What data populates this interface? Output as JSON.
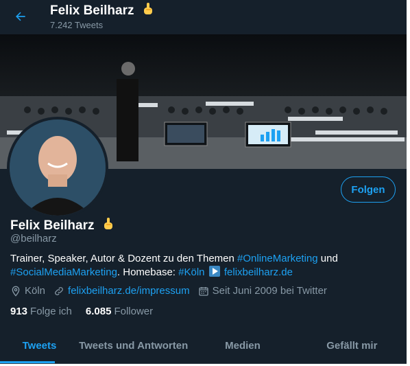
{
  "header": {
    "name": "Felix Beilharz",
    "tweet_count": "7.242 Tweets"
  },
  "profile": {
    "follow_label": "Folgen",
    "name": "Felix Beilharz",
    "handle": "@beilharz",
    "bio": {
      "line1_text": "Trainer, Speaker, Autor & Dozent zu den Themen ",
      "hashtag1": "#OnlineMarketing",
      "line1_end": " und",
      "hashtag2": "#SocialMediaMarketing",
      "homebase": ". Homebase: ",
      "hashtag3": "#Köln",
      "website": "felixbeilharz.de"
    },
    "location": "Köln",
    "url": "felixbeilharz.de/impressum",
    "joined": "Seit Juni 2009 bei Twitter",
    "following_count": "913",
    "following_label": "Folge ich",
    "followers_count": "6.085",
    "followers_label": "Follower"
  },
  "tabs": [
    {
      "label": "Tweets",
      "active": true
    },
    {
      "label": "Tweets und Antworten",
      "active": false
    },
    {
      "label": "Medien",
      "active": false
    },
    {
      "label": "Gefällt mir",
      "active": false
    }
  ],
  "colors": {
    "background": "#15202b",
    "accent": "#1da1f2",
    "muted": "#8899a6"
  }
}
